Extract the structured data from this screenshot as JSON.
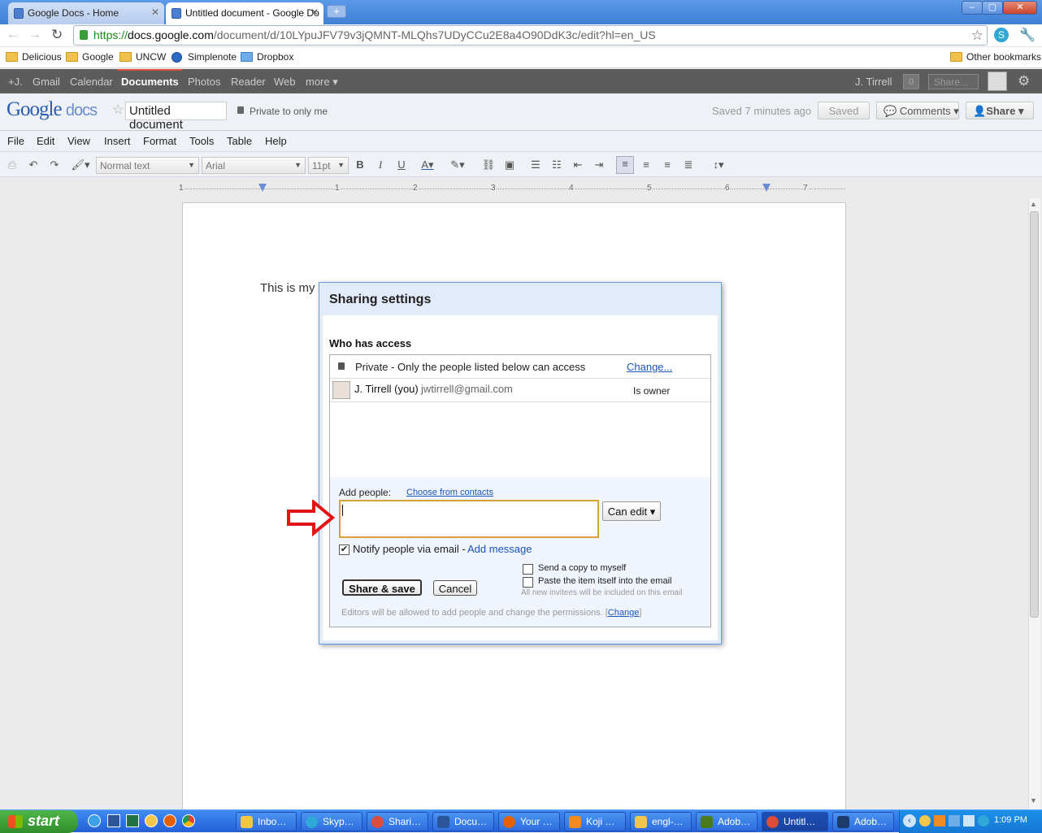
{
  "browser": {
    "tabs": [
      {
        "label": "Google Docs - Home"
      },
      {
        "label": "Untitled document - Google Do"
      }
    ],
    "url_scheme": "https://",
    "url_host": "docs.google.com",
    "url_path": "/document/d/10LYpuJFV79v3jQMNT-MLQhs7UDyCCu2E8a4O90DdK3c/edit?hl=en_US",
    "bookmarks": [
      "Delicious",
      "Google",
      "UNCW",
      "Simplenote",
      "Dropbox"
    ],
    "other_bookmarks": "Other bookmarks"
  },
  "gbar": {
    "items": [
      "+J.",
      "Gmail",
      "Calendar",
      "Documents",
      "Photos",
      "Reader",
      "Web",
      "more"
    ],
    "user": "J. Tirrell",
    "count": "0",
    "share": "Share..."
  },
  "docs": {
    "logo_google": "Google",
    "logo_docs": "docs",
    "title": "Untitled document",
    "privacy": "Private to only me",
    "saved_status": "Saved 7 minutes ago",
    "saved_btn": "Saved",
    "comments_btn": "Comments",
    "share_btn": "Share",
    "menu": [
      "File",
      "Edit",
      "View",
      "Insert",
      "Format",
      "Tools",
      "Table",
      "Help"
    ],
    "style_dd": "Normal text",
    "font_dd": "Arial",
    "size_dd": "11pt",
    "ruler": [
      "1",
      "1",
      "2",
      "3",
      "4",
      "5",
      "6",
      "7"
    ],
    "body_text": "This is my"
  },
  "dialog": {
    "title": "Sharing settings",
    "who_has_access": "Who has access",
    "private_text": "Private - Only the people listed below can access",
    "change_link": "Change...",
    "owner_name": "J. Tirrell (you)",
    "owner_email": "jwtirrell@gmail.com",
    "owner_role": "Is owner",
    "add_people_label": "Add people:",
    "choose_contacts": "Choose from contacts",
    "input_value": "",
    "permission": "Can edit",
    "notify_label": "Notify people via email -",
    "add_message": "Add message",
    "notify_checked": true,
    "send_copy": "Send a copy to myself",
    "paste_item": "Paste the item itself into the email",
    "invitees_note": "All new invitees will be included on this email",
    "share_save": "Share & save",
    "cancel": "Cancel",
    "editors_note": "Editors will be allowed to add people and change the permissions.",
    "editors_change": "Change"
  },
  "taskbar": {
    "start": "start",
    "items": [
      "Inbo…",
      "Skyp…",
      "Shari…",
      "Docu…",
      "Your …",
      "Koji …",
      "engl-…",
      "Adob…",
      "Untitl…",
      "Adob…"
    ],
    "clock": "1:09 PM"
  },
  "colors": {
    "arrow": "#e31414",
    "gbar": "#5c5c5c",
    "dialog_border": "#6c9ae0",
    "input_focus": "#d9a03c"
  }
}
